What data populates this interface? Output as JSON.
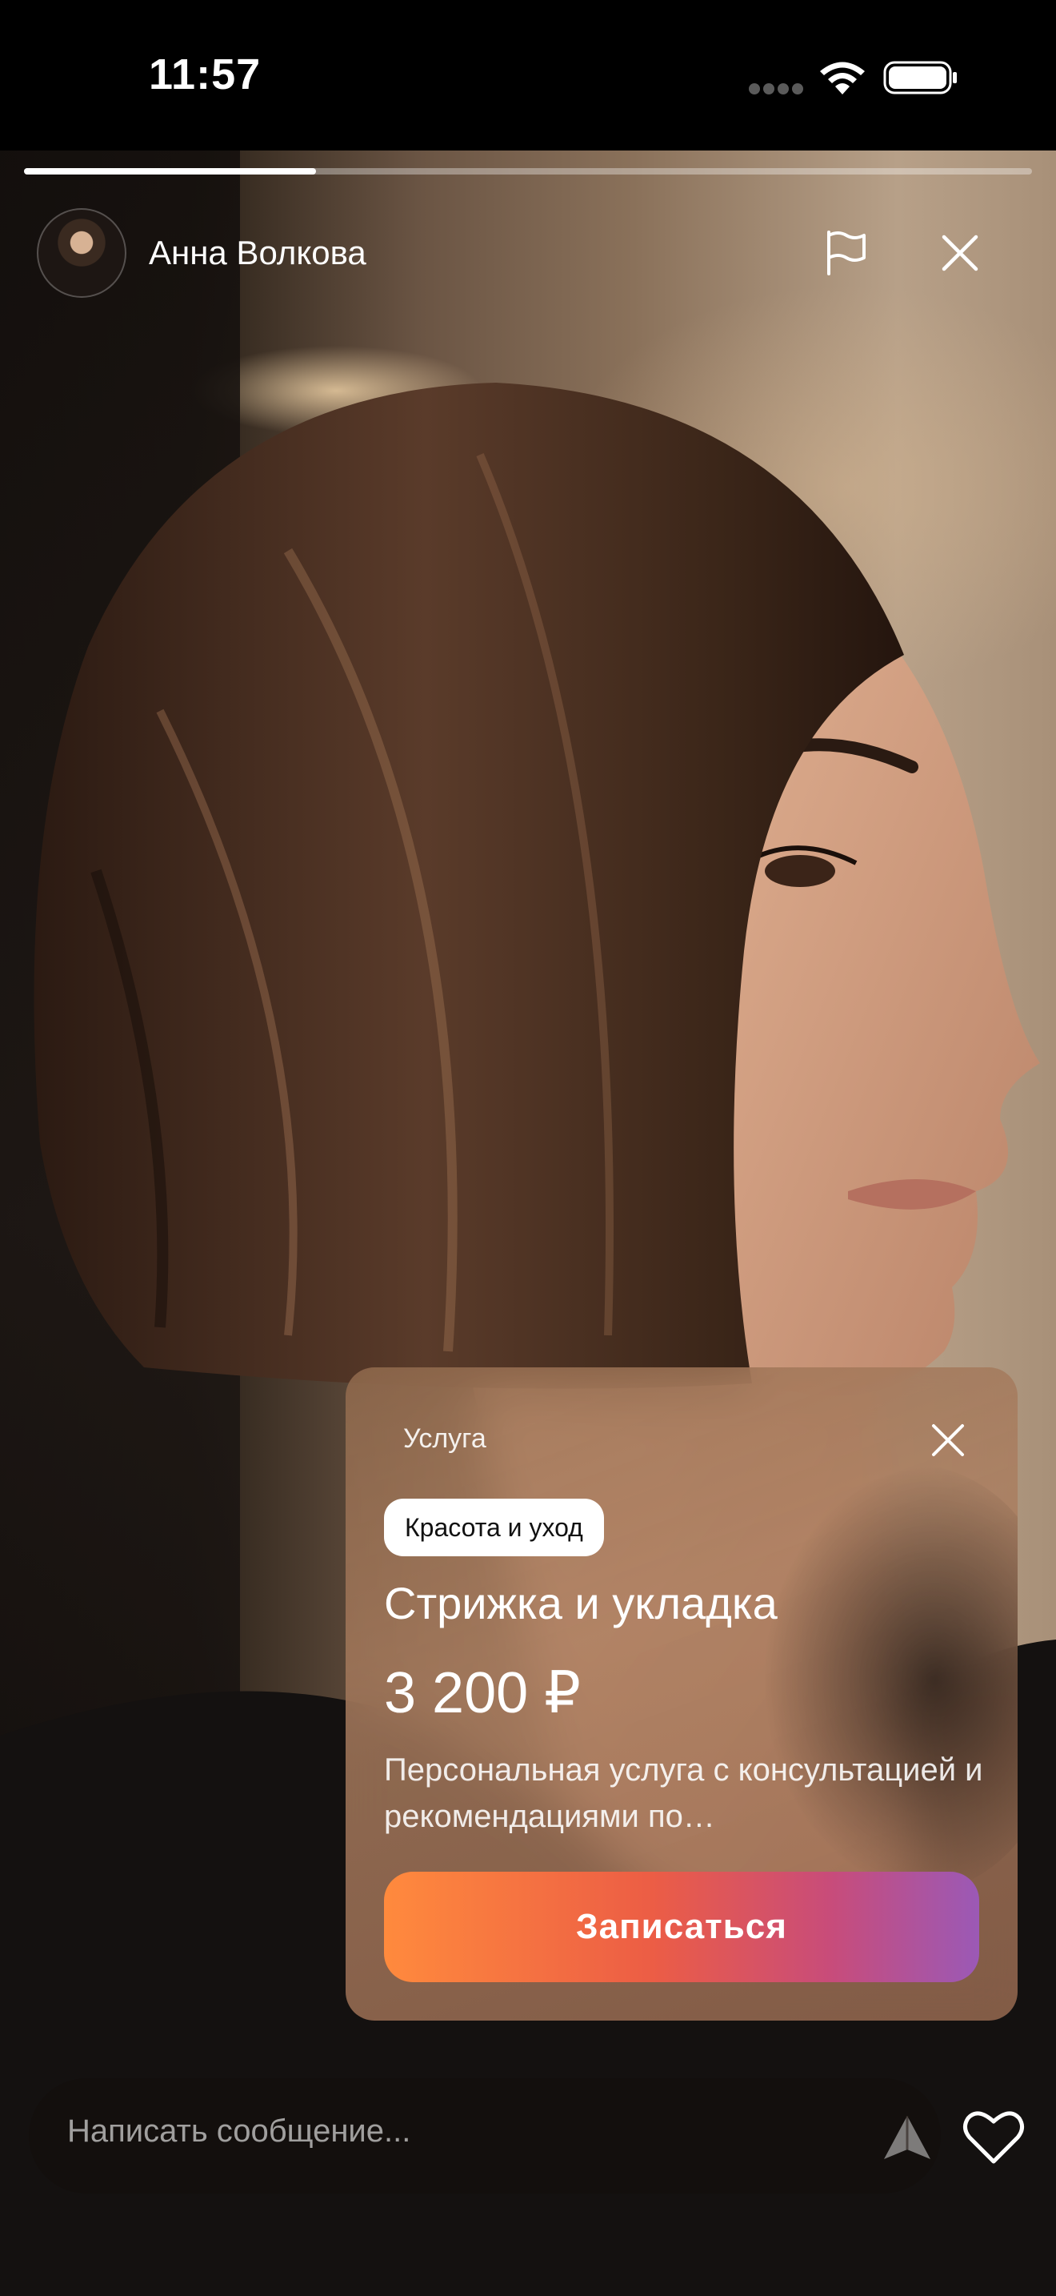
{
  "status_bar": {
    "time": "11:57"
  },
  "story": {
    "progress_fraction": 0.29,
    "author_name": "Анна Волкова"
  },
  "header_icons": {
    "report": "flag-icon",
    "close": "close-icon"
  },
  "card": {
    "type_label": "Услуга",
    "tag": "Красота и уход",
    "title": "Стрижка и укладка",
    "price": "3 200 ₽",
    "description": "Персональная услуга с консультацией и рекомендациями по…",
    "cta_label": "Записаться",
    "close_icon": "close-icon"
  },
  "composer": {
    "placeholder": "Написать сообщение...",
    "send_icon": "send-icon",
    "like_icon": "heart-icon"
  }
}
